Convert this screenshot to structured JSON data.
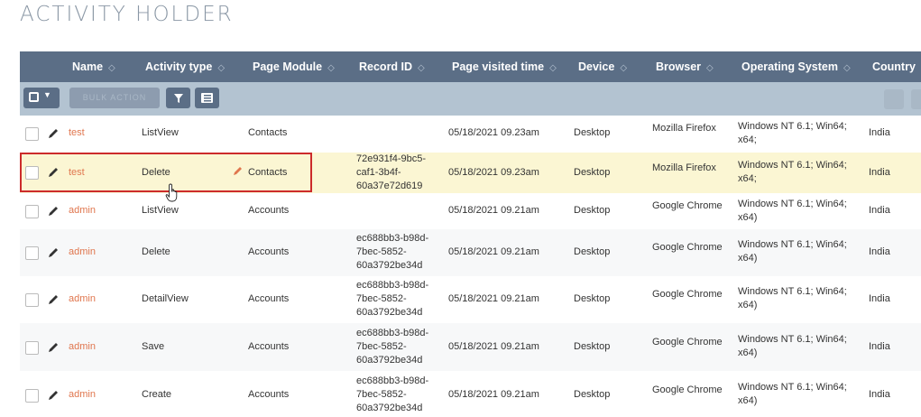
{
  "page": {
    "title": "ACTIVITY HOLDER"
  },
  "columns": [
    {
      "label": "Name"
    },
    {
      "label": "Activity type"
    },
    {
      "label": "Page Module"
    },
    {
      "label": "Record ID"
    },
    {
      "label": "Page visited time"
    },
    {
      "label": "Device"
    },
    {
      "label": "Browser"
    },
    {
      "label": "Operating System"
    },
    {
      "label": "Country"
    }
  ],
  "toolbar": {
    "bulk_action_label": "BULK ACTION"
  },
  "rows": [
    {
      "name": "test",
      "activity": "ListView",
      "module": "Contacts",
      "record_id": "",
      "visited": "05/18/2021 09.23am",
      "device": "Desktop",
      "browser": "Mozilla Firefox",
      "os": "Windows NT 6.1; Win64; x64;",
      "country": "India"
    },
    {
      "name": "test",
      "activity": "Delete",
      "module": "Contacts",
      "record_id": "72e931f4-9bc5-caf1-3b4f-60a37e72d619",
      "visited": "05/18/2021 09.23am",
      "device": "Desktop",
      "browser": "Mozilla Firefox",
      "os": "Windows NT 6.1; Win64; x64;",
      "country": "India"
    },
    {
      "name": "admin",
      "activity": "ListView",
      "module": "Accounts",
      "record_id": "",
      "visited": "05/18/2021 09.21am",
      "device": "Desktop",
      "browser": "Google Chrome",
      "os": "Windows NT 6.1; Win64; x64)",
      "country": "India"
    },
    {
      "name": "admin",
      "activity": "Delete",
      "module": "Accounts",
      "record_id": "ec688bb3-b98d-7bec-5852-60a3792be34d",
      "visited": "05/18/2021 09.21am",
      "device": "Desktop",
      "browser": "Google Chrome",
      "os": "Windows NT 6.1; Win64; x64)",
      "country": "India"
    },
    {
      "name": "admin",
      "activity": "DetailView",
      "module": "Accounts",
      "record_id": "ec688bb3-b98d-7bec-5852-60a3792be34d",
      "visited": "05/18/2021 09.21am",
      "device": "Desktop",
      "browser": "Google Chrome",
      "os": "Windows NT 6.1; Win64; x64)",
      "country": "India"
    },
    {
      "name": "admin",
      "activity": "Save",
      "module": "Accounts",
      "record_id": "ec688bb3-b98d-7bec-5852-60a3792be34d",
      "visited": "05/18/2021 09.21am",
      "device": "Desktop",
      "browser": "Google Chrome",
      "os": "Windows NT 6.1; Win64; x64)",
      "country": "India"
    },
    {
      "name": "admin",
      "activity": "Create",
      "module": "Accounts",
      "record_id": "ec688bb3-b98d-7bec-5852-60a3792be34d",
      "visited": "05/18/2021 09.21am",
      "device": "Desktop",
      "browser": "Google Chrome",
      "os": "Windows NT 6.1; Win64; x64)",
      "country": "India"
    }
  ],
  "colors": {
    "header_bg": "#5b6e86",
    "toolbar_bg": "#b3c3d1",
    "link": "#e0764e",
    "highlight_row": "#fbf6d3",
    "highlight_border": "#cc2b2b"
  },
  "icons": {
    "edit": "pencil-icon",
    "sort": "sort-arrows-icon",
    "filter": "filter-icon",
    "columns": "column-chooser-icon",
    "cursor": "hand-pointer-icon"
  }
}
